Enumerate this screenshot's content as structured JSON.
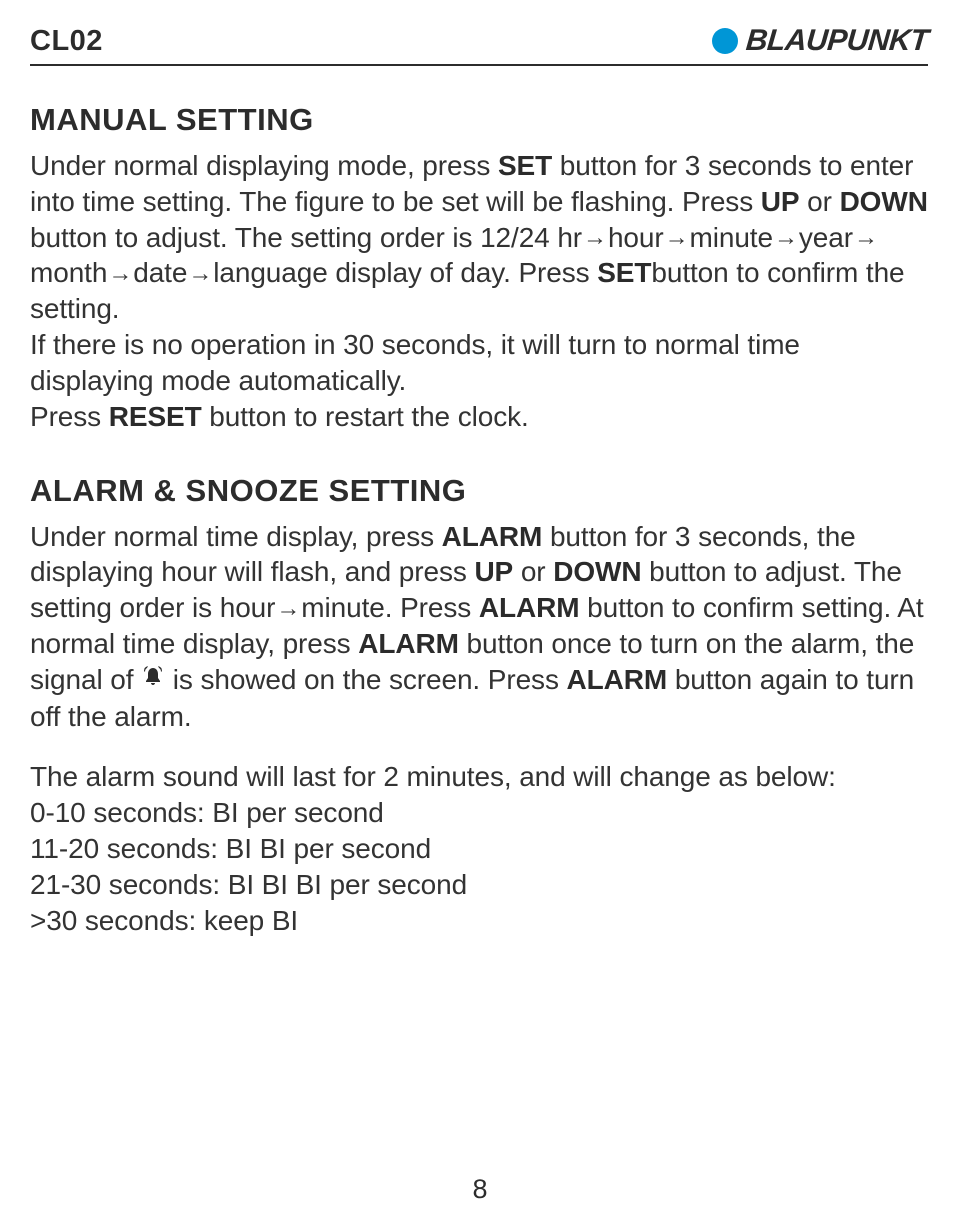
{
  "header": {
    "model": "CL02",
    "brand": "BLAUPUNKT"
  },
  "sections": {
    "manual": {
      "title": "MANUAL SETTING",
      "p1_a": "Under normal displaying mode, press ",
      "p1_set": "SET",
      "p1_b": " button for 3 seconds to enter into time setting. The figure to be set will be flashing. Press ",
      "p1_up": "UP",
      "p1_c": " or ",
      "p1_down": "DOWN",
      "p1_d": " button to adjust. The setting order is 12/24 hr",
      "seq": [
        "hour",
        "minute",
        "year",
        "month",
        "date",
        "language"
      ],
      "p1_e": " display of day. Press ",
      "p1_set2": "SET",
      "p1_f": "button to confirm the setting.",
      "p2": "If there is no operation in 30 seconds, it will turn to normal time displaying mode automatically.",
      "p3_a": "Press ",
      "p3_reset": "RESET",
      "p3_b": " button to restart the clock."
    },
    "alarm": {
      "title": "ALARM & SNOOZE SETTING",
      "p1_a": "Under normal time display, press ",
      "p1_alarm": "ALARM",
      "p1_b": " button for 3 seconds, the displaying hour will flash, and press ",
      "p1_up": "UP",
      "p1_c": " or ",
      "p1_down": "DOWN",
      "p1_d": " button to adjust. The setting order is hour",
      "p1_minute": "minute",
      "p1_e": ". Press ",
      "p1_alarm2": "ALARM",
      "p1_f": " button to confirm setting. At normal time display, press ",
      "p1_alarm3": "ALARM",
      "p1_g": " button once to turn on the alarm, the signal of ",
      "p1_h": " is showed on the screen. Press ",
      "p1_alarm4": "ALARM",
      "p1_i": " button again to turn off the alarm.",
      "p2": "The alarm sound will last for 2 minutes, and will change as below:",
      "lines": [
        "0-10 seconds: BI per second",
        "11-20 seconds: BI BI per second",
        "21-30 seconds: BI BI BI per second",
        ">30 seconds: keep BI"
      ]
    }
  },
  "page_number": "8"
}
